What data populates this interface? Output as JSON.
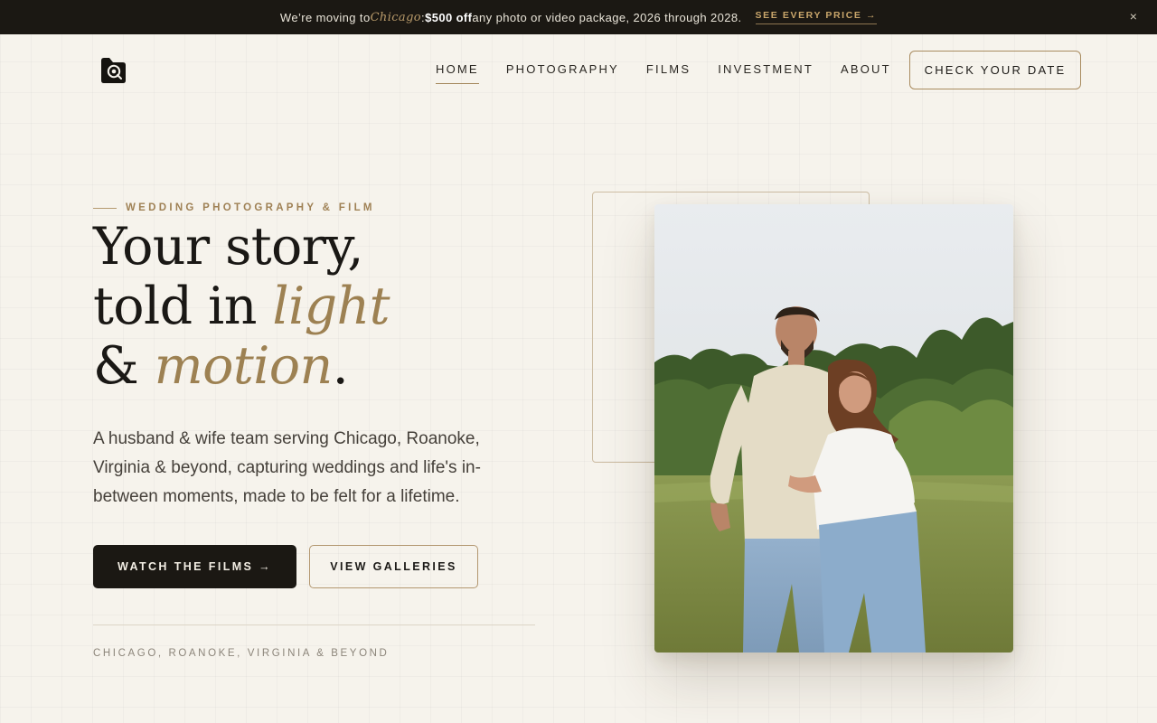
{
  "announcement": {
    "lead": "We’re moving to ",
    "city": "Chicago",
    "colon": ": ",
    "discount": "$500 off",
    "rest": " any photo or video package, 2026 through 2028.",
    "cta": "SEE EVERY PRICE →",
    "close_icon": "×"
  },
  "nav": {
    "logo_icon": "camera-lens-logo",
    "items": [
      {
        "label": "HOME",
        "active": true
      },
      {
        "label": "PHOTOGRAPHY",
        "active": false
      },
      {
        "label": "FILMS",
        "active": false
      },
      {
        "label": "INVESTMENT",
        "active": false
      },
      {
        "label": "ABOUT",
        "active": false
      }
    ],
    "cta": "CHECK YOUR DATE"
  },
  "hero": {
    "eyebrow": "WEDDING PHOTOGRAPHY & FILM",
    "headline": {
      "line1": "Your story,",
      "line2_pre": "told in ",
      "line2_accent": "light",
      "line3_pre": "& ",
      "line3_accent": "motion",
      "line3_post": "."
    },
    "lede": "A husband & wife team serving Chicago, Roanoke, Virginia & beyond, capturing weddings and life's in-between moments, made to be felt for a lifetime.",
    "primary_button": "WATCH THE FILMS  →",
    "secondary_button": "VIEW GALLERIES",
    "locations": "CHICAGO, ROANOKE, VIRGINIA & BEYOND"
  },
  "colors": {
    "background": "#f6f3ec",
    "dark": "#1b1813",
    "accent_gold": "#9d8152"
  }
}
